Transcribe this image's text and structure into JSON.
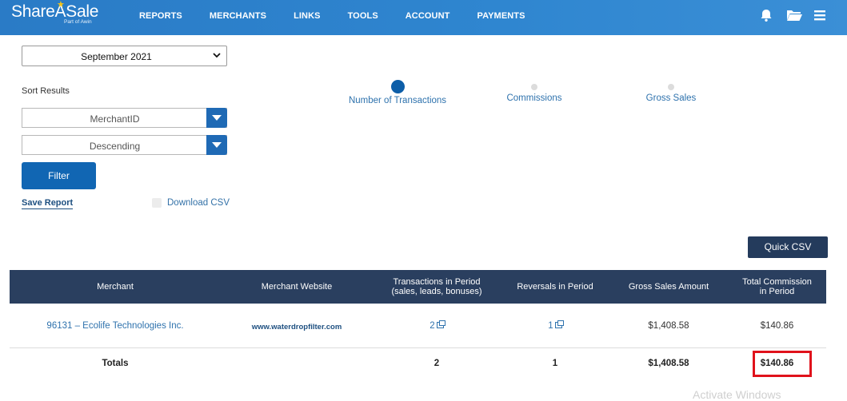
{
  "header": {
    "logo_text": "ShareASale",
    "logo_sub": "Part of Awin",
    "nav": [
      "REPORTS",
      "MERCHANTS",
      "LINKS",
      "TOOLS",
      "ACCOUNT",
      "PAYMENTS"
    ],
    "icons": [
      "bell-icon",
      "folder-icon",
      "menu-icon"
    ],
    "color": "#2f86d0"
  },
  "controls": {
    "month_select": "September 2021",
    "sort_label": "Sort Results",
    "sort_by": "MerchantID",
    "sort_order": "Descending",
    "filter_label": "Filter",
    "save_report": "Save Report",
    "download_csv": "Download CSV"
  },
  "metrics": [
    {
      "label": "Number of Transactions",
      "active": true
    },
    {
      "label": "Commissions",
      "active": false
    },
    {
      "label": "Gross Sales",
      "active": false
    }
  ],
  "quick_csv": "Quick CSV",
  "table": {
    "columns": [
      "Merchant",
      "Merchant Website",
      "Transactions in Period (sales, leads, bonuses)",
      "Reversals in Period",
      "Gross Sales Amount",
      "Total Commission in Period"
    ],
    "col_lines": {
      "tx": [
        "Transactions in Period",
        "(sales, leads, bonuses)"
      ],
      "commission": [
        "Total Commission",
        "in Period"
      ]
    },
    "rows": [
      {
        "merchant": "96131 – Ecolife Technologies Inc.",
        "website": "www.waterdropfilter.com",
        "transactions": "2",
        "reversals": "1",
        "gross_sales": "$1,408.58",
        "commission": "$140.86"
      }
    ],
    "totals": {
      "label": "Totals",
      "transactions": "2",
      "reversals": "1",
      "gross_sales": "$1,408.58",
      "commission": "$140.86"
    }
  },
  "watermark": "Activate Windows"
}
